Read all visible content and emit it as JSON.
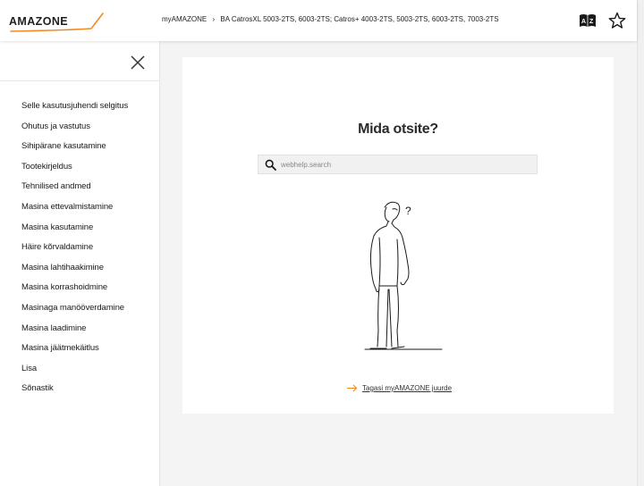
{
  "header": {
    "logo_text": "AMAZONE",
    "breadcrumb": {
      "root": "myAMAZONE",
      "separator": "›",
      "current": "BA CatrosXL 5003-2TS, 6003-2TS; Catros+ 4003-2TS, 5003-2TS, 6003-2TS, 7003-2TS"
    },
    "icons": [
      "dictionary-icon",
      "star-icon"
    ]
  },
  "sidebar": {
    "items": [
      {
        "label": "Selle kasutusjuhendi selgitus"
      },
      {
        "label": "Ohutus ja vastutus"
      },
      {
        "label": "Sihipärane kasutamine"
      },
      {
        "label": "Tootekirjeldus"
      },
      {
        "label": "Tehnilised andmed"
      },
      {
        "label": "Masina ettevalmistamine"
      },
      {
        "label": "Masina kasutamine"
      },
      {
        "label": "Häire kõrvaldamine"
      },
      {
        "label": "Masina lahtihaakimine"
      },
      {
        "label": "Masina korrashoidmine"
      },
      {
        "label": "Masinaga manööverdamine"
      },
      {
        "label": "Masina laadimine"
      },
      {
        "label": "Masina jäätmekäitlus"
      },
      {
        "label": "Lisa"
      },
      {
        "label": "Sõnastik"
      }
    ]
  },
  "main": {
    "title": "Mida otsite?",
    "search": {
      "placeholder": "webhelp.search",
      "value": ""
    },
    "back_link": "Tagasi myAMAZONE juurde",
    "illustration_mark": "?"
  },
  "colors": {
    "accent": "#f08a24",
    "background": "#f4f4f4",
    "text": "#1a1a1a"
  }
}
